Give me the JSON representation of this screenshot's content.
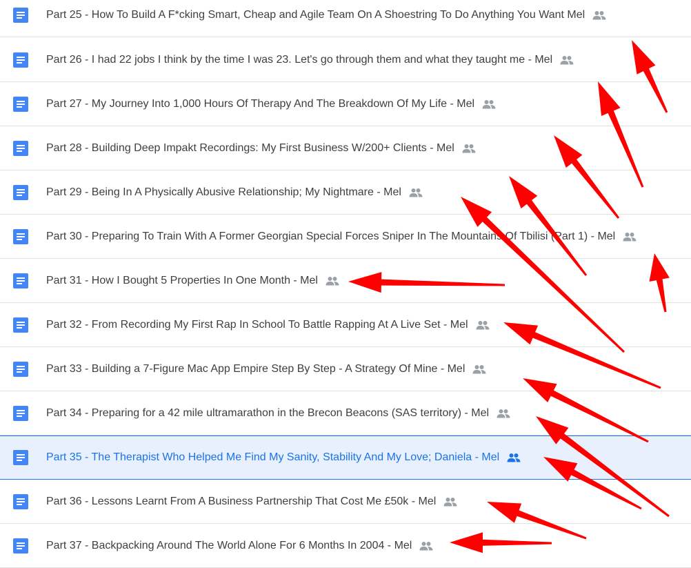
{
  "files": [
    {
      "title": "Part 25 - How To Build A F*cking Smart, Cheap and Agile Team On A Shoestring To Do Anything You Want Mel",
      "shared": true,
      "selected": false
    },
    {
      "title": "Part 26 - I had 22 jobs I think by the time I was 23. Let's go through them and what they taught me - Mel",
      "shared": true,
      "selected": false
    },
    {
      "title": "Part 27 - My Journey Into 1,000 Hours Of Therapy And The Breakdown Of My Life - Mel",
      "shared": true,
      "selected": false
    },
    {
      "title": "Part 28 - Building Deep Impakt Recordings: My First Business W/200+ Clients - Mel",
      "shared": true,
      "selected": false
    },
    {
      "title": "Part 29 - Being In A Physically Abusive Relationship; My Nightmare - Mel",
      "shared": true,
      "selected": false
    },
    {
      "title": "Part 30 - Preparing To Train With A Former Georgian Special Forces Sniper In The Mountains Of Tbilisi (Part 1) - Mel",
      "shared": true,
      "selected": false
    },
    {
      "title": "Part 31 - How I Bought 5 Properties In One Month - Mel",
      "shared": true,
      "selected": false
    },
    {
      "title": "Part 32 - From Recording My First Rap In School To Battle Rapping At A Live Set - Mel",
      "shared": true,
      "selected": false
    },
    {
      "title": "Part 33 - Building a 7-Figure Mac App Empire Step By Step - A Strategy Of Mine - Mel",
      "shared": true,
      "selected": false
    },
    {
      "title": "Part 34 - Preparing for a 42 mile ultramarathon in the Brecon Beacons (SAS territory) - Mel",
      "shared": true,
      "selected": false
    },
    {
      "title": "Part 35 - The Therapist Who Helped Me Find My Sanity, Stability And My Love; Daniela - Mel",
      "shared": true,
      "selected": true
    },
    {
      "title": "Part 36 - Lessons Learnt From A Business Partnership That Cost Me £50k - Mel",
      "shared": true,
      "selected": false
    },
    {
      "title": "Part 37 - Backpacking Around The World Alone For 6 Months In 2004 - Mel",
      "shared": true,
      "selected": false
    }
  ],
  "icons": {
    "file_type": "google-docs-icon",
    "shared": "people-icon",
    "annotation": "red-arrow-annotation"
  },
  "colors": {
    "doc_icon": "#4285f4",
    "selected_accent": "#1a73e8",
    "selected_background": "#e8f0fe",
    "text": "#3c4043",
    "shared_icon": "#9aa0a6",
    "arrow": "#ff0000"
  }
}
